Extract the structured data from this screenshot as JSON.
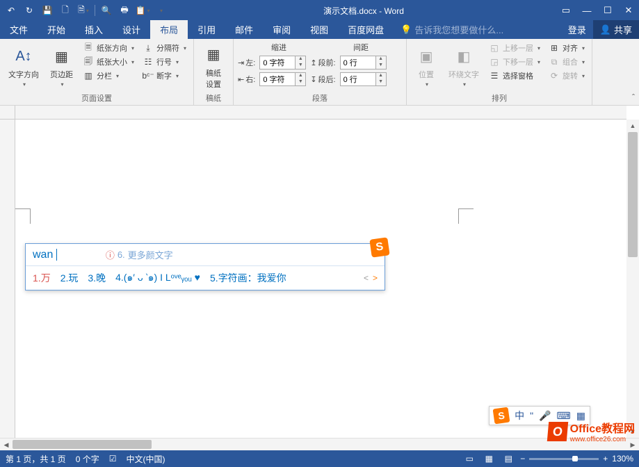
{
  "title": "演示文档.docx - Word",
  "tabs": {
    "file": "文件",
    "home": "开始",
    "insert": "插入",
    "design": "设计",
    "layout": "布局",
    "references": "引用",
    "mailings": "邮件",
    "review": "审阅",
    "view": "视图",
    "baidu": "百度网盘"
  },
  "tell_me": "告诉我您想要做什么...",
  "login": "登录",
  "share": "共享",
  "ribbon": {
    "page_setup": {
      "text_direction": "文字方向",
      "margins": "页边距",
      "orientation": "纸张方向",
      "size": "纸张大小",
      "columns": "分栏",
      "breaks": "分隔符",
      "line_numbers": "行号",
      "hyphenation": "断字",
      "label": "页面设置"
    },
    "manuscript": {
      "button": "稿纸\n设置",
      "label": "稿纸"
    },
    "paragraph": {
      "indent_hdr": "缩进",
      "spacing_hdr": "间距",
      "left": "左:",
      "right": "右:",
      "before": "段前:",
      "after": "段后:",
      "indent_val": "0 字符",
      "spacing_val": "0 行",
      "label": "段落"
    },
    "arrange": {
      "position": "位置",
      "wrap": "环绕文字",
      "bring_forward": "上移一层",
      "send_backward": "下移一层",
      "selection_pane": "选择窗格",
      "align": "对齐",
      "group": "组合",
      "rotate": "旋转",
      "label": "排列"
    }
  },
  "ime": {
    "input": "wan",
    "hint_num": "6.",
    "hint_text": "更多颜文字",
    "candidates": [
      {
        "n": "1.",
        "t": "万"
      },
      {
        "n": "2.",
        "t": "玩"
      },
      {
        "n": "3.",
        "t": "晚"
      },
      {
        "n": "4.",
        "t": "(๑′ ᴗ ‵๑) I Lᵒᵛᵉᵧₒᵤ ♥"
      },
      {
        "n": "5.",
        "t": "字符画：我爱你"
      }
    ]
  },
  "ime_status": {
    "lang": "中"
  },
  "status": {
    "page": "第 1 页，共 1 页",
    "words": "0 个字",
    "lang": "中文(中国)",
    "zoom": "130%"
  },
  "watermark": {
    "title": "Office教程网",
    "url": "www.office26.com"
  }
}
